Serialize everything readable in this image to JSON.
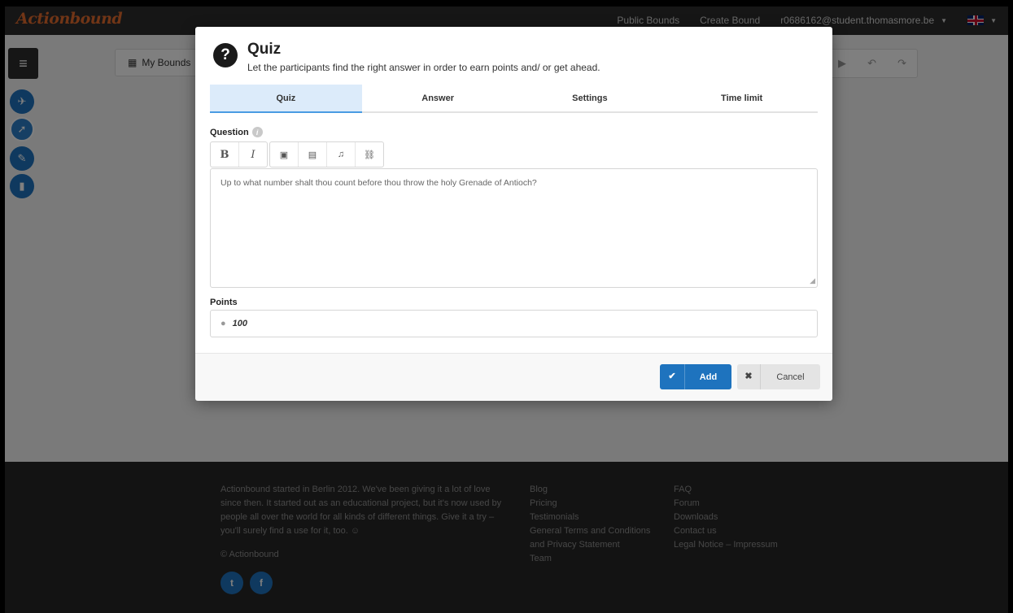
{
  "app": {
    "logo": "Actionbound"
  },
  "topnav": {
    "public_bounds": "Public Bounds",
    "create_bound": "Create Bound",
    "user_email": "r0686162@student.thomasmore.be"
  },
  "background": {
    "my_bounds": "My Bounds",
    "sidebar_icons": [
      "route-icon",
      "compass-icon",
      "wrench-icon",
      "stats-icon"
    ]
  },
  "footer": {
    "about": "Actionbound started in Berlin 2012. We've been giving it a lot of love since then. It started out as an educational project, but it's now used by people all over the world for all kinds of different things. Give it a try – you'll surely find a use for it, too. ☺",
    "copyright": "© Actionbound",
    "social": {
      "twitter": "t",
      "facebook": "f"
    },
    "links_col1": [
      "Blog",
      "Pricing",
      "Testimonials",
      "General Terms and Conditions and Privacy Statement",
      "Team"
    ],
    "links_col2": [
      "FAQ",
      "Forum",
      "Downloads",
      "Contact us",
      "Legal Notice – Impressum"
    ]
  },
  "modal": {
    "icon": "?",
    "title": "Quiz",
    "subtitle": "Let the participants find the right answer in order to earn points and/ or get ahead.",
    "tabs": [
      {
        "label": "Quiz",
        "active": true
      },
      {
        "label": "Answer",
        "active": false
      },
      {
        "label": "Settings",
        "active": false
      },
      {
        "label": "Time limit",
        "active": false
      }
    ],
    "question_label": "Question",
    "question_text": "Up to what number shalt thou count before thou throw the holy Grenade of Antioch?",
    "points_label": "Points",
    "points_value": "100",
    "add_label": "Add",
    "cancel_label": "Cancel"
  },
  "colors": {
    "accent": "#1e73be",
    "logo": "#e26a2c",
    "active_tab": "#dcebfa"
  }
}
